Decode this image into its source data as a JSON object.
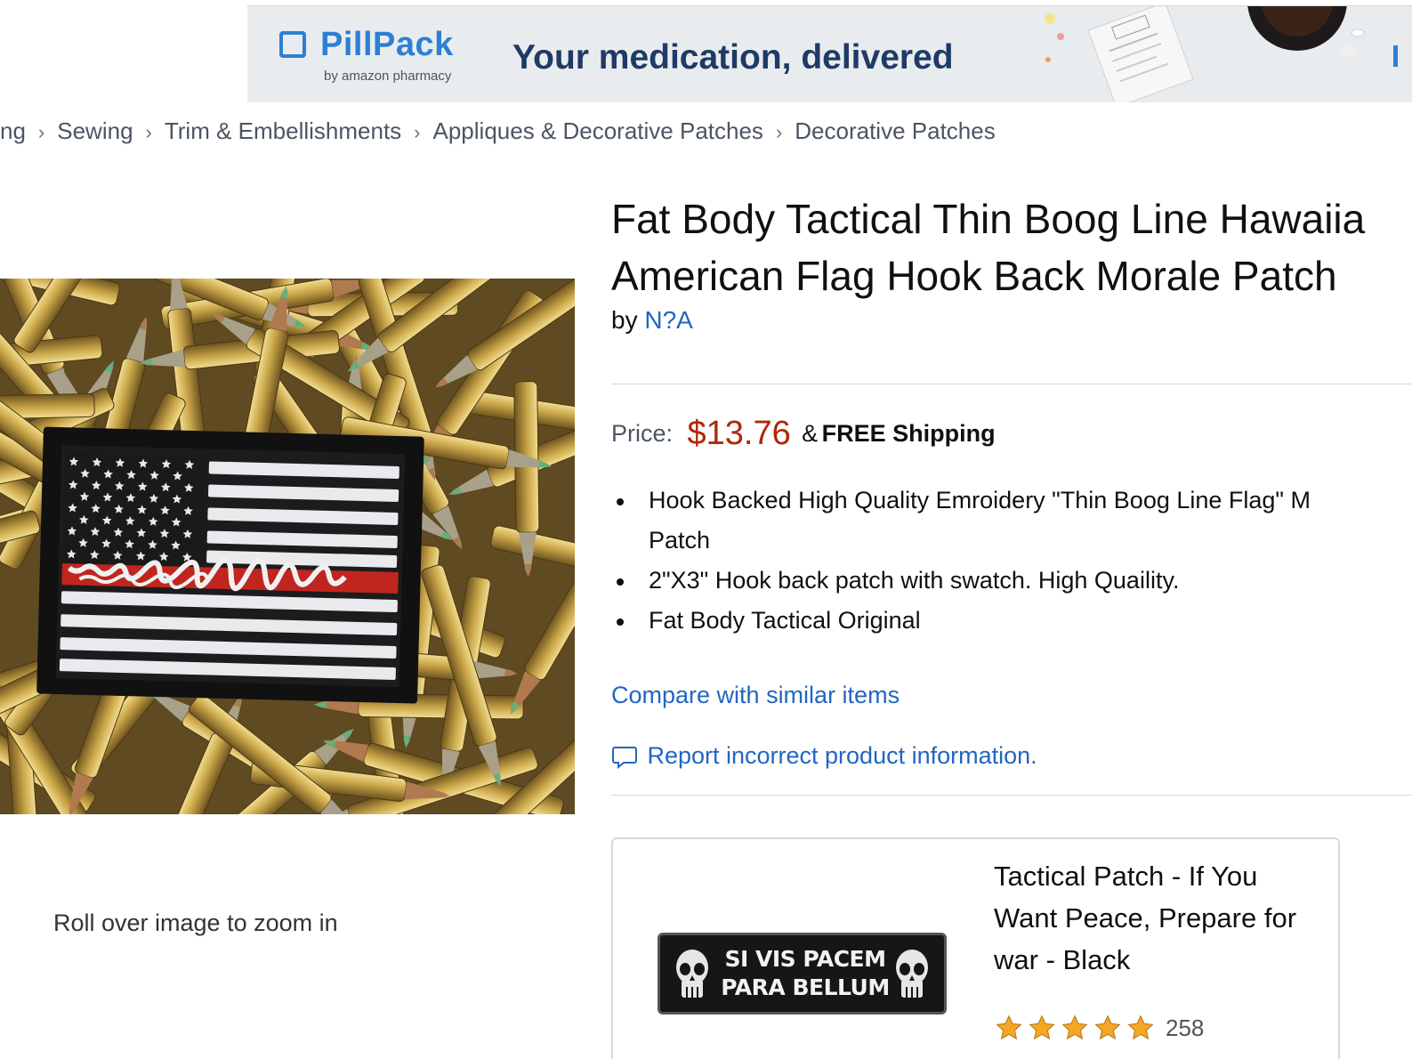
{
  "banner": {
    "brand": "PillPack",
    "brand_sub": "by amazon pharmacy",
    "tagline": "Your medication, delivered"
  },
  "breadcrumb": {
    "items": [
      "ng",
      "Sewing",
      "Trim & Embellishments",
      "Appliques & Decorative Patches",
      "Decorative Patches"
    ],
    "separator": "›"
  },
  "product": {
    "title_line1": "Fat Body Tactical Thin Boog Line Hawaiia",
    "title_line2": "American Flag Hook Back Morale Patch",
    "by_label": "by",
    "brand": "N?A",
    "zoom_hint": "Roll over image to zoom in",
    "price_label": "Price:",
    "price": "$13.76",
    "price_amp": "&",
    "shipping": "FREE Shipping",
    "bullets": [
      "Hook Backed High Quality Emroidery \"Thin Boog Line Flag\" M",
      "2\"X3\" Hook back patch with swatch. High Quaility.",
      "Fat Body Tactical Original"
    ],
    "bullet1_cont": "Patch",
    "compare_link": "Compare with similar items",
    "report_link": "Report incorrect product information."
  },
  "sponsored": {
    "patch_text_line1": "SI VIS PACEM",
    "patch_text_line2": "PARA BELLUM",
    "title": "Tactical Patch - If You Want Peace, Prepare for war - Black",
    "rating": 5,
    "rating_count": "258"
  },
  "colors": {
    "link": "#2266c2",
    "price": "#b12704",
    "brand_blue": "#2d7fd3",
    "tagline": "#1f3a66",
    "star": "#f5a623"
  },
  "icons": [
    "chevron-right-icon",
    "chat-bubble-icon",
    "star-icon",
    "skull-icon",
    "pill-icon"
  ]
}
